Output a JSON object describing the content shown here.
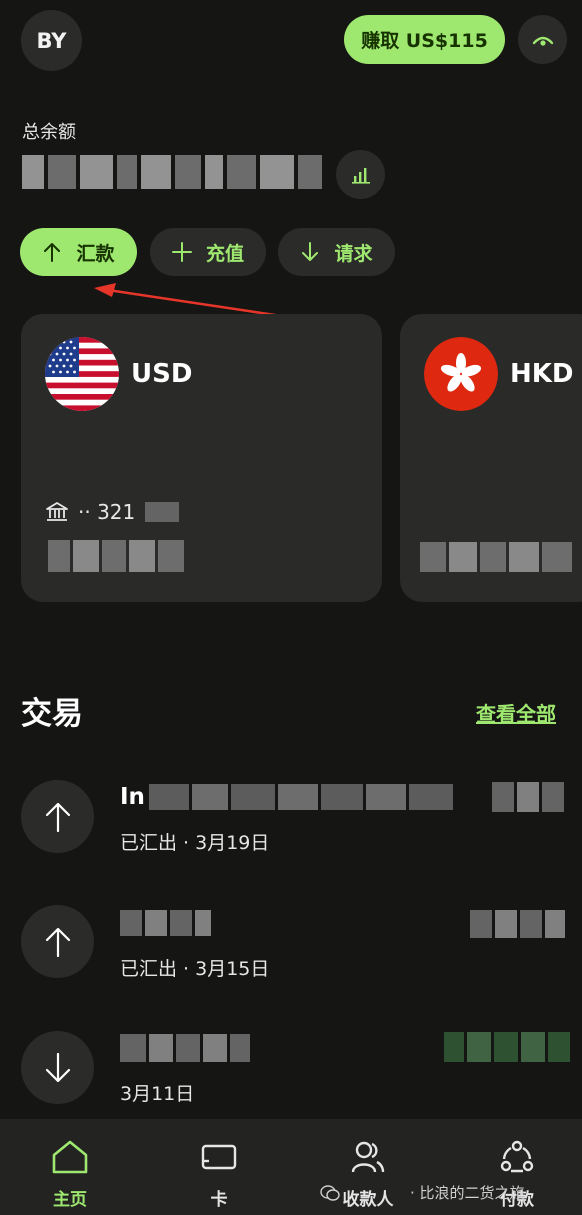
{
  "header": {
    "avatar_initials": "BY",
    "earn_button": "赚取 US$115"
  },
  "balance": {
    "label": "总余额"
  },
  "actions": {
    "send": "汇款",
    "topup": "充值",
    "request": "请求"
  },
  "accounts": [
    {
      "code": "USD",
      "bank_prefix": "·· 321"
    },
    {
      "code": "HKD"
    }
  ],
  "transactions": {
    "title": "交易",
    "see_all": "查看全部",
    "items": [
      {
        "name_prefix": "In",
        "direction": "out",
        "status": "已汇出 · 3月19日"
      },
      {
        "name_prefix": "",
        "direction": "out",
        "status": "已汇出 · 3月15日"
      },
      {
        "name_prefix": "",
        "direction": "in",
        "status": "3月11日"
      }
    ]
  },
  "bottom_nav": {
    "home": "主页",
    "card": "卡",
    "recipients": "收款人",
    "payments": "付款"
  },
  "watermark": "· 比浪的二货之旅",
  "colors": {
    "accent": "#9fe870",
    "accent_text": "#163300",
    "background": "#151614",
    "surface": "#2a2b29",
    "annotation_arrow": "#e8352a"
  }
}
